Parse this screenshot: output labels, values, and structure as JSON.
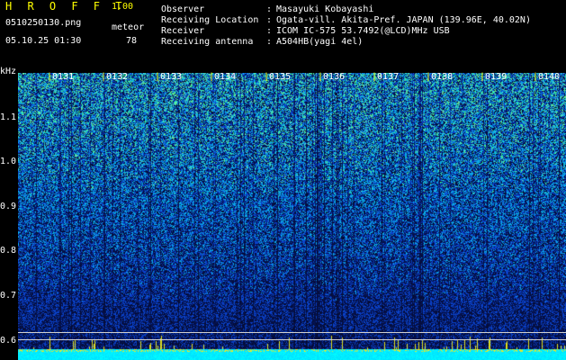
{
  "header": {
    "brand": "H R O F F T",
    "version": "1.00",
    "filename": "0510250130.png",
    "meteor_label": "meteor",
    "datetime": "05.10.25 01:30",
    "meteor_count": "78",
    "info": [
      {
        "label": "Observer",
        "value": "Masayuki Kobayashi"
      },
      {
        "label": "Receiving Location",
        "value": "Ogata-vill. Akita-Pref. JAPAN (139.96E, 40.02N)"
      },
      {
        "label": "Receiver",
        "value": "ICOM IC-575 53.7492(@LCD)MHz USB"
      },
      {
        "label": "Receiving antenna",
        "value": "A504HB(yagi 4el)"
      }
    ]
  },
  "axes": {
    "y_unit": "kHz",
    "y_ticks": [
      "1.1",
      "1.0",
      "0.9",
      "0.8",
      "0.7",
      "0.6"
    ],
    "x_ticks": [
      "0131",
      "0132",
      "0133",
      "0134",
      "0135",
      "0136",
      "0137",
      "0138",
      "0139",
      "0140"
    ]
  },
  "colors": {
    "background": "#000000",
    "accent_yellow": "#ffff00",
    "text": "#ffffff",
    "spectrum_low": "#0a1a5a",
    "spectrum_mid": "#2060ff",
    "spectrum_high": "#30e0b0",
    "baseline_band": "#00e0ff"
  }
}
